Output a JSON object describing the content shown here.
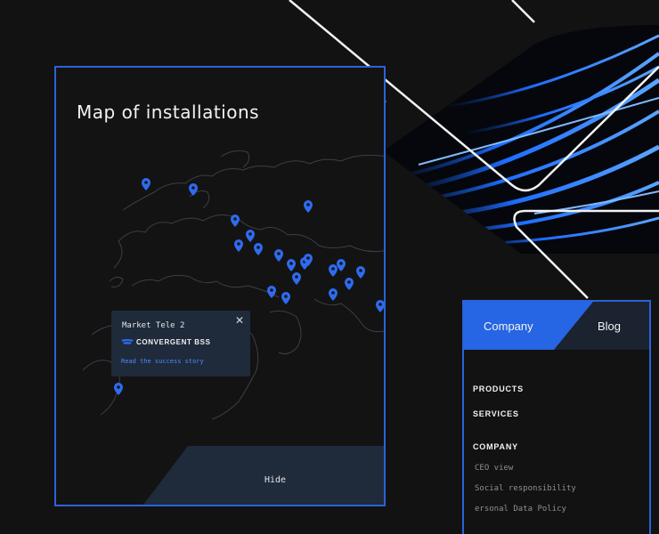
{
  "map": {
    "title": "Map of installations",
    "pin_color": "#2e6bf0",
    "popup": {
      "market": "Market Tele 2",
      "product": "CONVERGENT BSS",
      "link": "Read the success story",
      "close_icon": "close-icon"
    },
    "hide_label": "Hide"
  },
  "menu": {
    "tabs": {
      "company": "Company",
      "blog": "Blog"
    },
    "products": "PRODUCTS",
    "services": "SERVICES",
    "company": "COMPANY",
    "company_items": [
      "CEO view",
      "Social responsibility",
      "ersonal Data Policy"
    ]
  },
  "colors": {
    "accent": "#2a63d9",
    "tab_active": "#2665e3",
    "panel_dark": "#1f2a3b"
  }
}
